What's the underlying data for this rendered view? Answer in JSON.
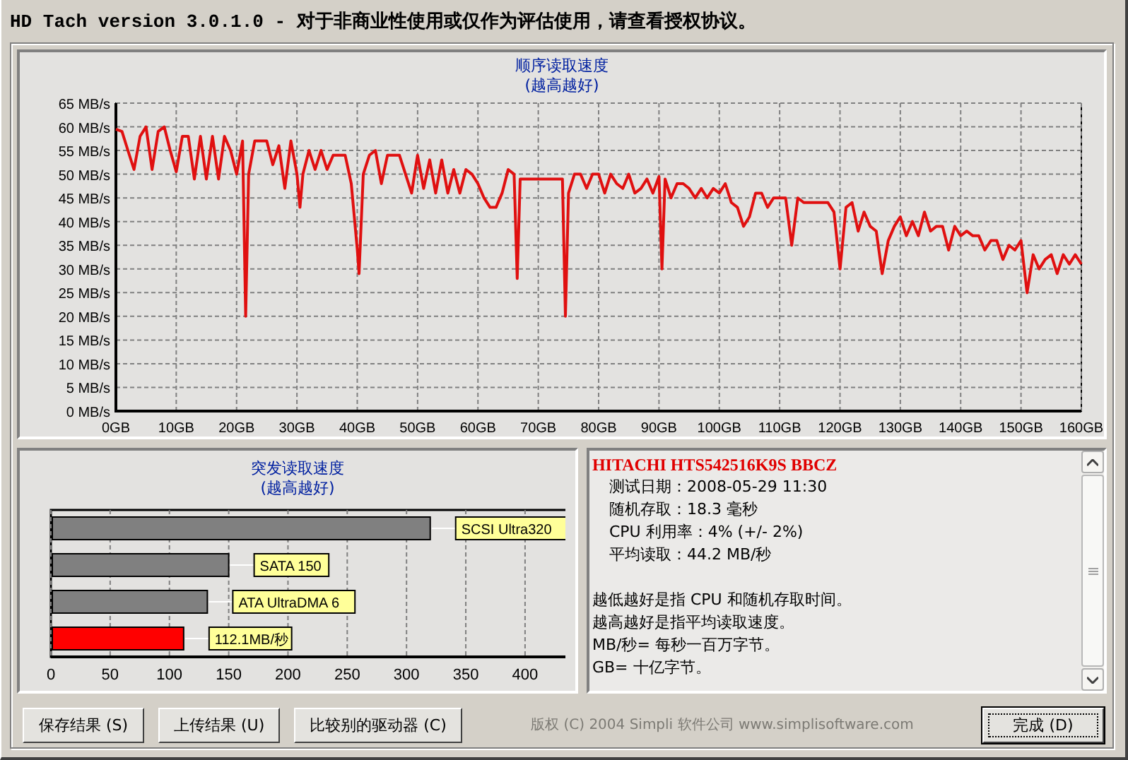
{
  "window": {
    "title": "HD Tach version 3.0.1.0  - 对于非商业性使用或仅作为评估使用，请查看授权协议。"
  },
  "sequential": {
    "title": "顺序读取速度",
    "subtitle": "(越高越好)",
    "chart_data": {
      "type": "line",
      "grid": true,
      "xlim": [
        0,
        160
      ],
      "ylim": [
        0,
        65
      ],
      "xticks": [
        {
          "value": 0,
          "label": "0GB"
        },
        {
          "value": 10,
          "label": "10GB"
        },
        {
          "value": 20,
          "label": "20GB"
        },
        {
          "value": 30,
          "label": "30GB"
        },
        {
          "value": 40,
          "label": "40GB"
        },
        {
          "value": 50,
          "label": "50GB"
        },
        {
          "value": 60,
          "label": "60GB"
        },
        {
          "value": 70,
          "label": "70GB"
        },
        {
          "value": 80,
          "label": "80GB"
        },
        {
          "value": 90,
          "label": "90GB"
        },
        {
          "value": 100,
          "label": "100GB"
        },
        {
          "value": 110,
          "label": "110GB"
        },
        {
          "value": 120,
          "label": "120GB"
        },
        {
          "value": 130,
          "label": "130GB"
        },
        {
          "value": 140,
          "label": "140GB"
        },
        {
          "value": 150,
          "label": "150GB"
        },
        {
          "value": 160,
          "label": "160GB"
        }
      ],
      "yticks": [
        {
          "value": 0,
          "label": "0 MB/s"
        },
        {
          "value": 5,
          "label": "5 MB/s"
        },
        {
          "value": 10,
          "label": "10 MB/s"
        },
        {
          "value": 15,
          "label": "15 MB/s"
        },
        {
          "value": 20,
          "label": "20 MB/s"
        },
        {
          "value": 25,
          "label": "25 MB/s"
        },
        {
          "value": 30,
          "label": "30 MB/s"
        },
        {
          "value": 35,
          "label": "35 MB/s"
        },
        {
          "value": 40,
          "label": "40 MB/s"
        },
        {
          "value": 45,
          "label": "45 MB/s"
        },
        {
          "value": 50,
          "label": "50 MB/s"
        },
        {
          "value": 55,
          "label": "55 MB/s"
        },
        {
          "value": 60,
          "label": "60 MB/s"
        },
        {
          "value": 65,
          "label": "65 MB/s"
        }
      ],
      "x": [
        0,
        1,
        2,
        3,
        4,
        5,
        6,
        7,
        8,
        9,
        10,
        11,
        12,
        13,
        14,
        15,
        16,
        17,
        18,
        19,
        20,
        21,
        21.5,
        22,
        23,
        24,
        25,
        26,
        27,
        28,
        29,
        30,
        30.5,
        31,
        32,
        33,
        34,
        35,
        36,
        37,
        38,
        39,
        40,
        40.3,
        41,
        42,
        43,
        44,
        45,
        46,
        47,
        48,
        49,
        50,
        51,
        52,
        53,
        54,
        55,
        56,
        57,
        58,
        59,
        60,
        61,
        62,
        63,
        64,
        65,
        66,
        66.5,
        67,
        70,
        74,
        74.5,
        75,
        76,
        77,
        78,
        79,
        80,
        81,
        82,
        83,
        84,
        85,
        86,
        87,
        88,
        89,
        90,
        90.5,
        91,
        92,
        93,
        94,
        95,
        96,
        97,
        98,
        99,
        100,
        101,
        102,
        103,
        104,
        105,
        106,
        107,
        108,
        109,
        110,
        111,
        112,
        113,
        114,
        115,
        116,
        117,
        118,
        119,
        120,
        121,
        122,
        123,
        124,
        125,
        126,
        127,
        128,
        129,
        130,
        131,
        132,
        133,
        134,
        135,
        136,
        137,
        138,
        139,
        140,
        141,
        142,
        143,
        144,
        145,
        146,
        147,
        148,
        149,
        150,
        151,
        152,
        153,
        154,
        155,
        156,
        157,
        158,
        159,
        160
      ],
      "series": [
        {
          "color": "#e01010",
          "values": [
            59.5,
            59,
            55,
            51,
            58,
            60,
            51,
            59,
            60,
            55,
            50.5,
            58,
            58,
            49,
            58,
            49,
            58,
            49,
            58,
            55,
            50,
            57,
            20,
            50,
            57,
            57,
            57,
            52,
            56,
            47,
            57,
            50,
            43,
            50,
            55,
            51,
            55,
            51,
            54,
            54,
            54,
            48,
            34,
            29,
            50,
            54,
            55,
            48,
            54,
            54,
            54,
            50,
            46,
            54,
            47,
            53,
            46,
            53,
            46,
            51,
            46,
            51,
            50,
            48,
            45,
            43,
            43,
            46,
            51,
            50,
            28,
            49,
            49,
            49,
            20,
            46,
            50,
            50,
            47,
            50,
            50,
            46,
            50,
            48,
            47,
            50,
            46,
            47,
            49,
            46,
            49.5,
            30,
            49,
            45,
            48,
            48,
            47,
            45,
            47,
            45,
            47,
            46,
            48,
            44,
            43,
            39,
            41,
            46,
            46,
            43,
            45,
            45,
            45,
            35,
            45,
            44,
            44,
            44,
            44,
            44,
            42,
            30,
            43,
            44,
            38,
            42,
            39,
            38,
            29,
            36,
            39,
            41,
            37,
            40,
            37,
            42,
            38,
            39,
            39,
            34,
            39,
            37,
            38,
            37,
            37,
            34,
            36,
            36,
            32,
            35,
            34,
            36,
            25,
            33,
            30,
            32,
            33,
            29,
            33,
            31,
            33,
            31
          ]
        }
      ]
    }
  },
  "burst": {
    "title": "突发读取速度",
    "subtitle": "(越高越好)",
    "chart_data": {
      "type": "bar",
      "orientation": "horizontal",
      "grid": true,
      "xlim": [
        0,
        440
      ],
      "xticks": [
        0,
        50,
        100,
        150,
        200,
        250,
        300,
        350,
        400
      ],
      "categories": [
        "SCSI Ultra320",
        "SATA 150",
        "ATA UltraDMA 6",
        "112.1MB/秒"
      ],
      "series": [
        {
          "color": "#808080",
          "values": [
            320,
            150,
            132,
            null
          ]
        },
        {
          "color": "#ff0000",
          "values": [
            null,
            null,
            null,
            112
          ]
        }
      ]
    }
  },
  "info": {
    "drive": "HITACHI HTS542516K9S BBCZ",
    "stats": [
      {
        "label": "测试日期：",
        "value": "2008-05-29    11:30"
      },
      {
        "label": "随机存取：",
        "value": "18.3 毫秒"
      },
      {
        "label": "CPU 利用率：",
        "value": "4% (+/- 2%)"
      },
      {
        "label": "平均读取：",
        "value": "44.2 MB/秒"
      }
    ],
    "notes": [
      "越低越好是指 CPU 和随机存取时间。",
      "越高越好是指平均读取速度。",
      "MB/秒= 每秒一百万字节。",
      "GB= 十亿字节。"
    ]
  },
  "buttons": [
    {
      "label": "保存结果 (S)"
    },
    {
      "label": "上传结果 (U)"
    },
    {
      "label": "比较别的驱动器 (C)"
    }
  ],
  "copyright": "版权 (C) 2004 Simpli 软件公司 www.simplisoftware.com",
  "done_button": {
    "label": "完成 (D)",
    "focused": true
  }
}
